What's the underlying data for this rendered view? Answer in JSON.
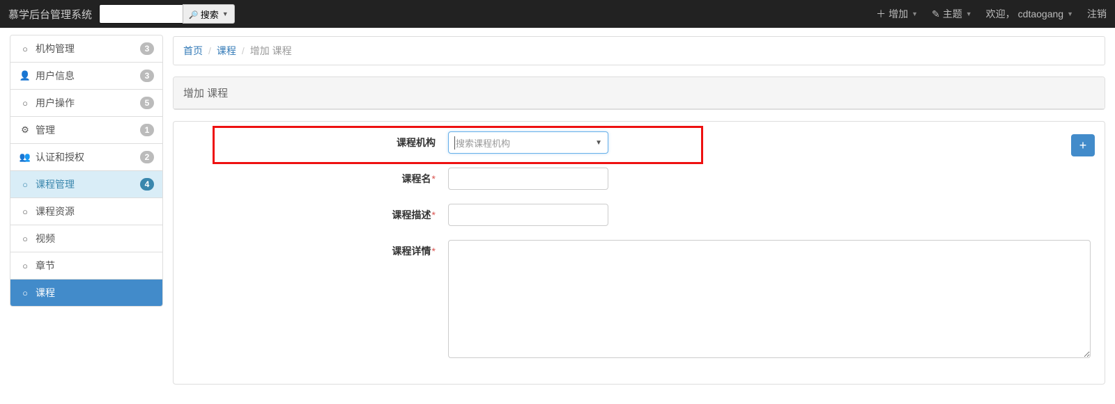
{
  "nav": {
    "brand": "慕学后台管理系统",
    "search_placeholder": "",
    "search_label": "搜索",
    "add_label": "增加",
    "theme_label": "主题",
    "welcome_prefix": "欢迎，",
    "username": "cdtaogang",
    "logout_label": "注销"
  },
  "sidebar": {
    "items": [
      {
        "icon": "○",
        "label": "机构管理",
        "badge": "3"
      },
      {
        "icon": "👤",
        "label": "用户信息",
        "badge": "3"
      },
      {
        "icon": "○",
        "label": "用户操作",
        "badge": "5"
      },
      {
        "icon": "⚙",
        "label": "管理",
        "badge": "1"
      },
      {
        "icon": "👥",
        "label": "认证和授权",
        "badge": "2"
      },
      {
        "icon": "○",
        "label": "课程管理",
        "badge": "4",
        "active_parent": true
      },
      {
        "icon": "○",
        "label": "课程资源"
      },
      {
        "icon": "○",
        "label": "视频"
      },
      {
        "icon": "○",
        "label": "章节"
      },
      {
        "icon": "○",
        "label": "课程",
        "active_child": true
      }
    ]
  },
  "breadcrumb": {
    "home": "首页",
    "section": "课程",
    "current": "增加 课程"
  },
  "panel": {
    "title": "增加 课程"
  },
  "form": {
    "org_label": "课程机构",
    "org_placeholder": "搜索课程机构",
    "name_label": "课程名",
    "desc_label": "课程描述",
    "detail_label": "课程详情",
    "add_inline_tooltip": "+"
  }
}
